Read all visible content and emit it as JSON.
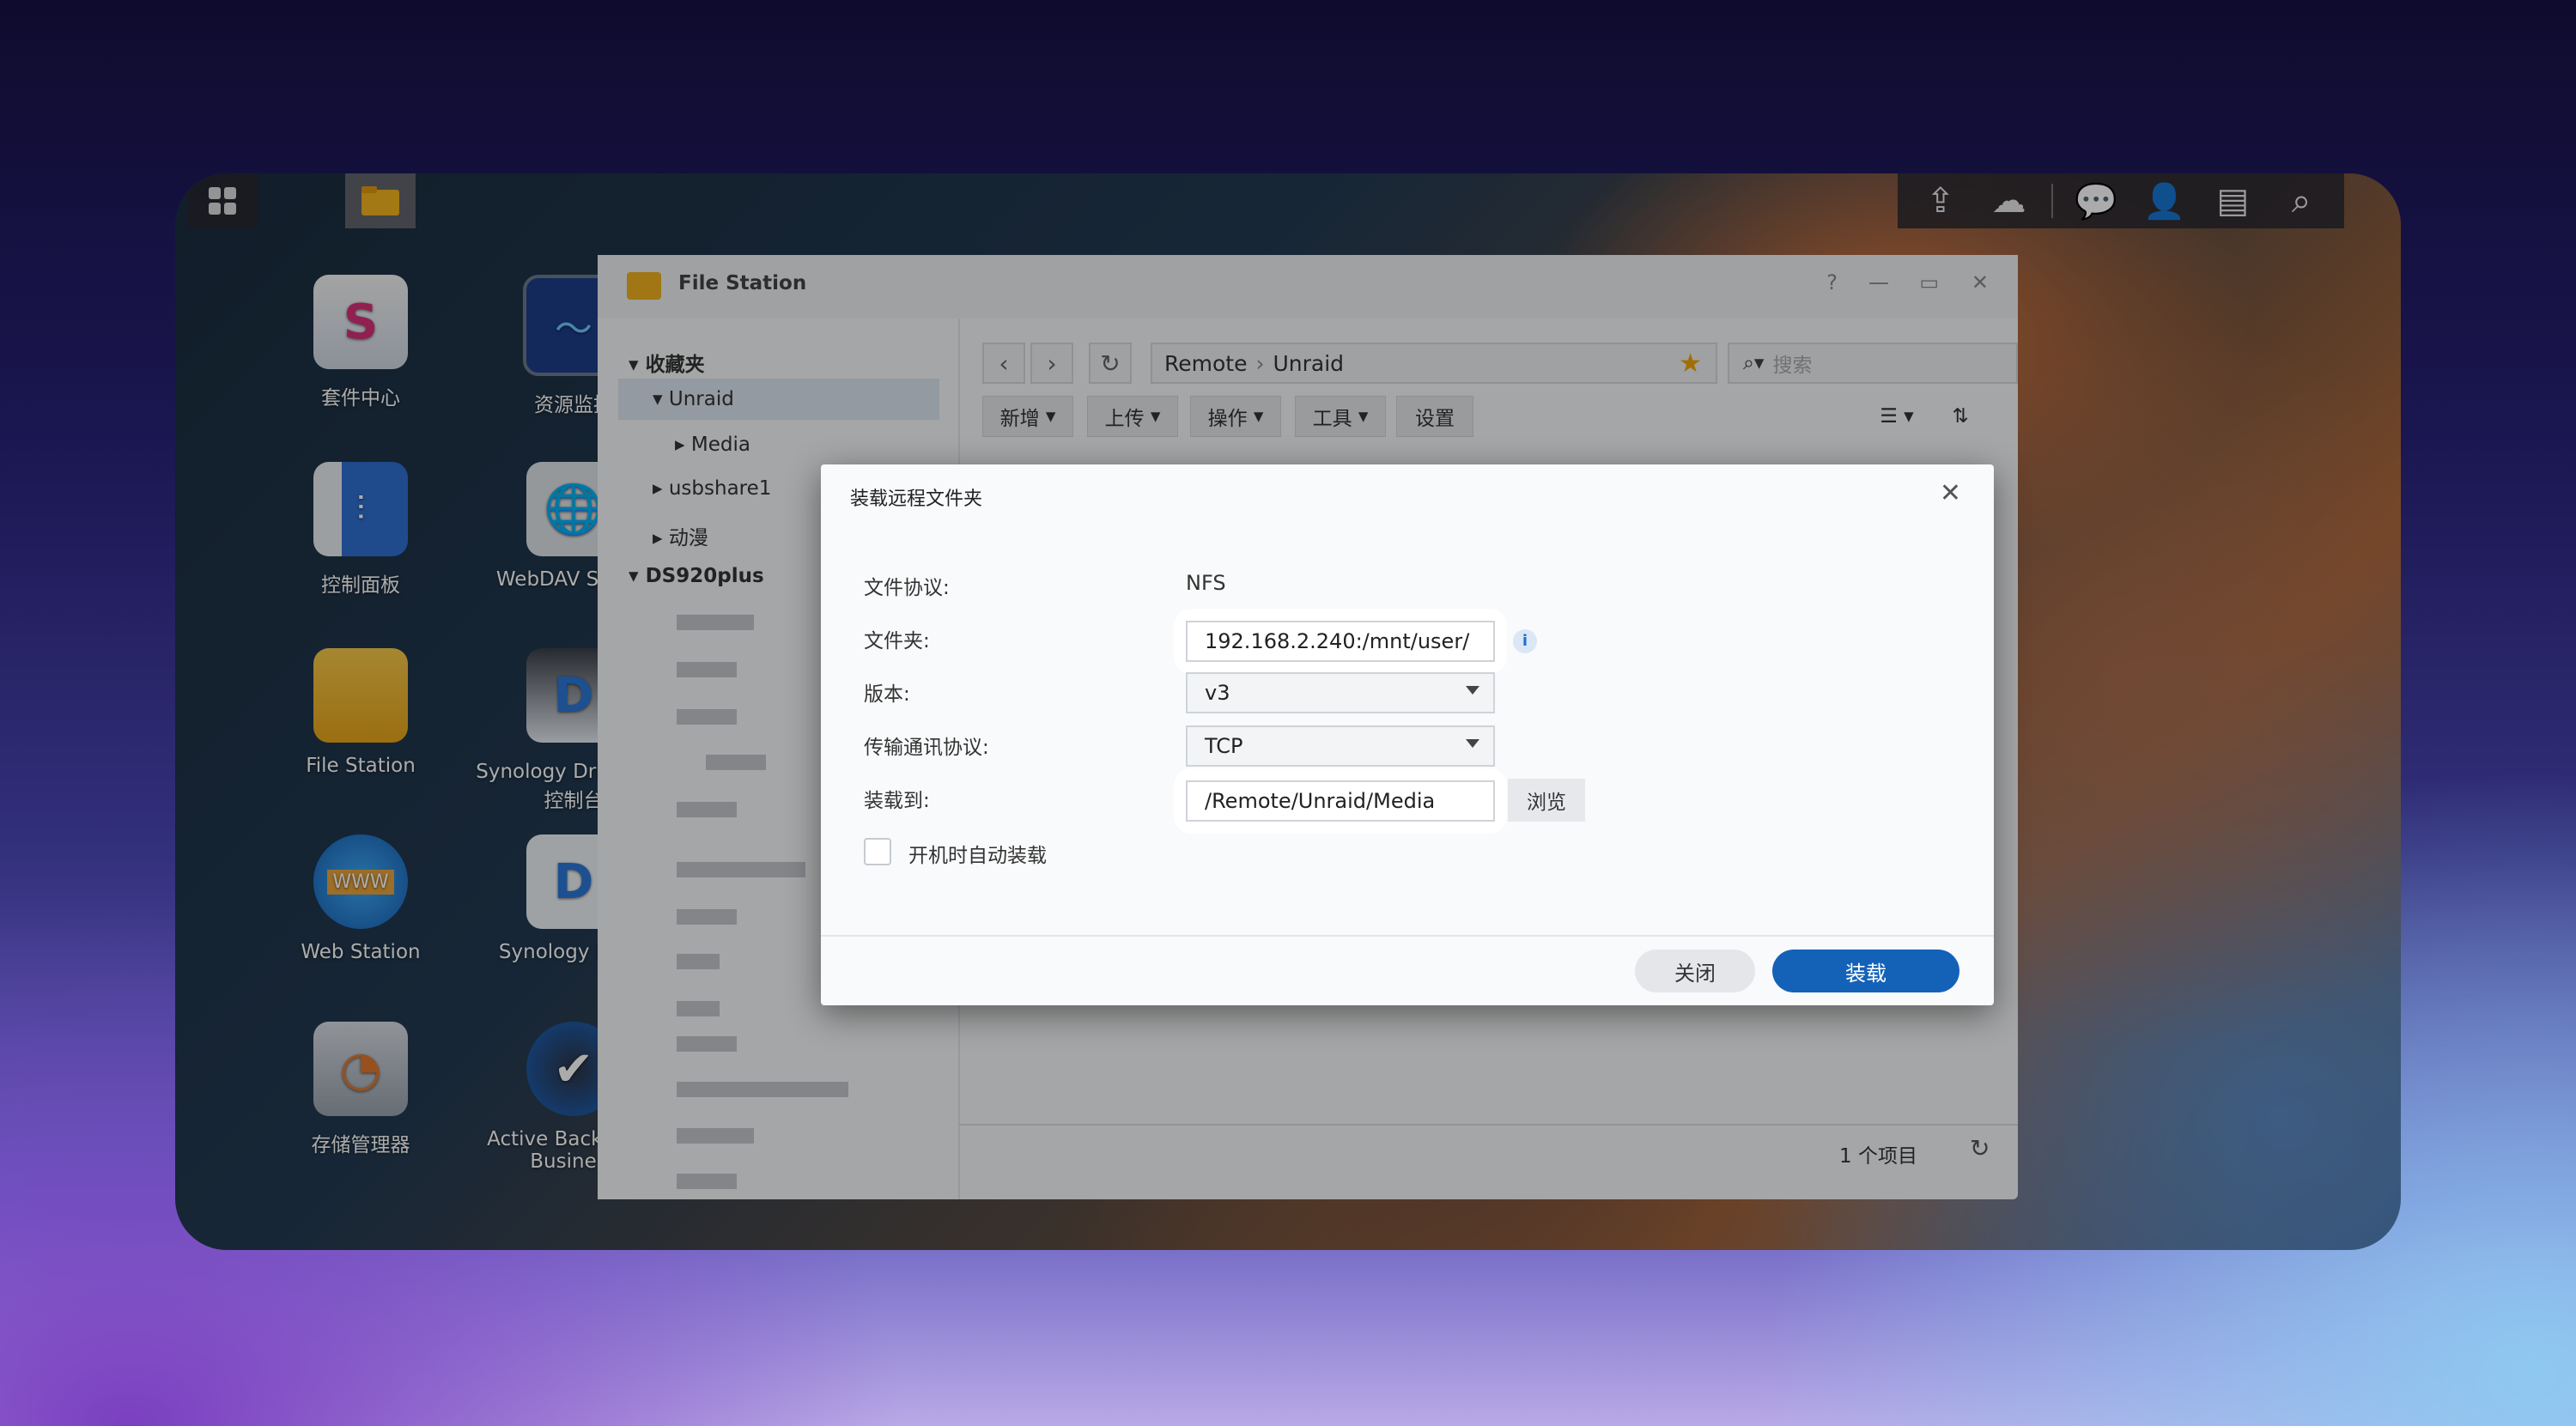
{
  "desktop": {
    "icons": [
      {
        "label": "套件中心"
      },
      {
        "label": "资源监控"
      },
      {
        "label": "控制面板"
      },
      {
        "label": "WebDAV Server"
      },
      {
        "label": "File Station"
      },
      {
        "label": "Synology Drive 管理控制台"
      },
      {
        "label": "Web Station"
      },
      {
        "label": "Synology Drive"
      },
      {
        "label": "存储管理器"
      },
      {
        "label": "Active Backup for Business"
      }
    ]
  },
  "window": {
    "title": "File Station",
    "controls": {
      "help": "?",
      "minimize": "—",
      "maximize": "▭",
      "close": "✕"
    }
  },
  "sidebar": {
    "favorites": "收藏夹",
    "unraid": "Unraid",
    "media": "Media",
    "usbshare": "usbshare1",
    "anime": "动漫",
    "ds": "DS920plus"
  },
  "toolbar": {
    "path_root": "Remote",
    "path_leaf": "Unraid",
    "search_placeholder": "搜索",
    "new": "新增",
    "upload": "上传",
    "action": "操作",
    "tools": "工具",
    "settings": "设置"
  },
  "status": {
    "count": "1 个项目"
  },
  "dialog": {
    "title": "装载远程文件夹",
    "protocol_label": "文件协议:",
    "protocol_value": "NFS",
    "folder_label": "文件夹:",
    "folder_value": "192.168.2.240:/mnt/user/",
    "version_label": "版本:",
    "version_value": "v3",
    "transport_label": "传输通讯协议:",
    "transport_value": "TCP",
    "mount_label": "装载到:",
    "mount_value": "/Remote/Unraid/Media",
    "browse": "浏览",
    "auto_mount": "开机时自动装载",
    "btn_close": "关闭",
    "btn_mount": "装载"
  }
}
